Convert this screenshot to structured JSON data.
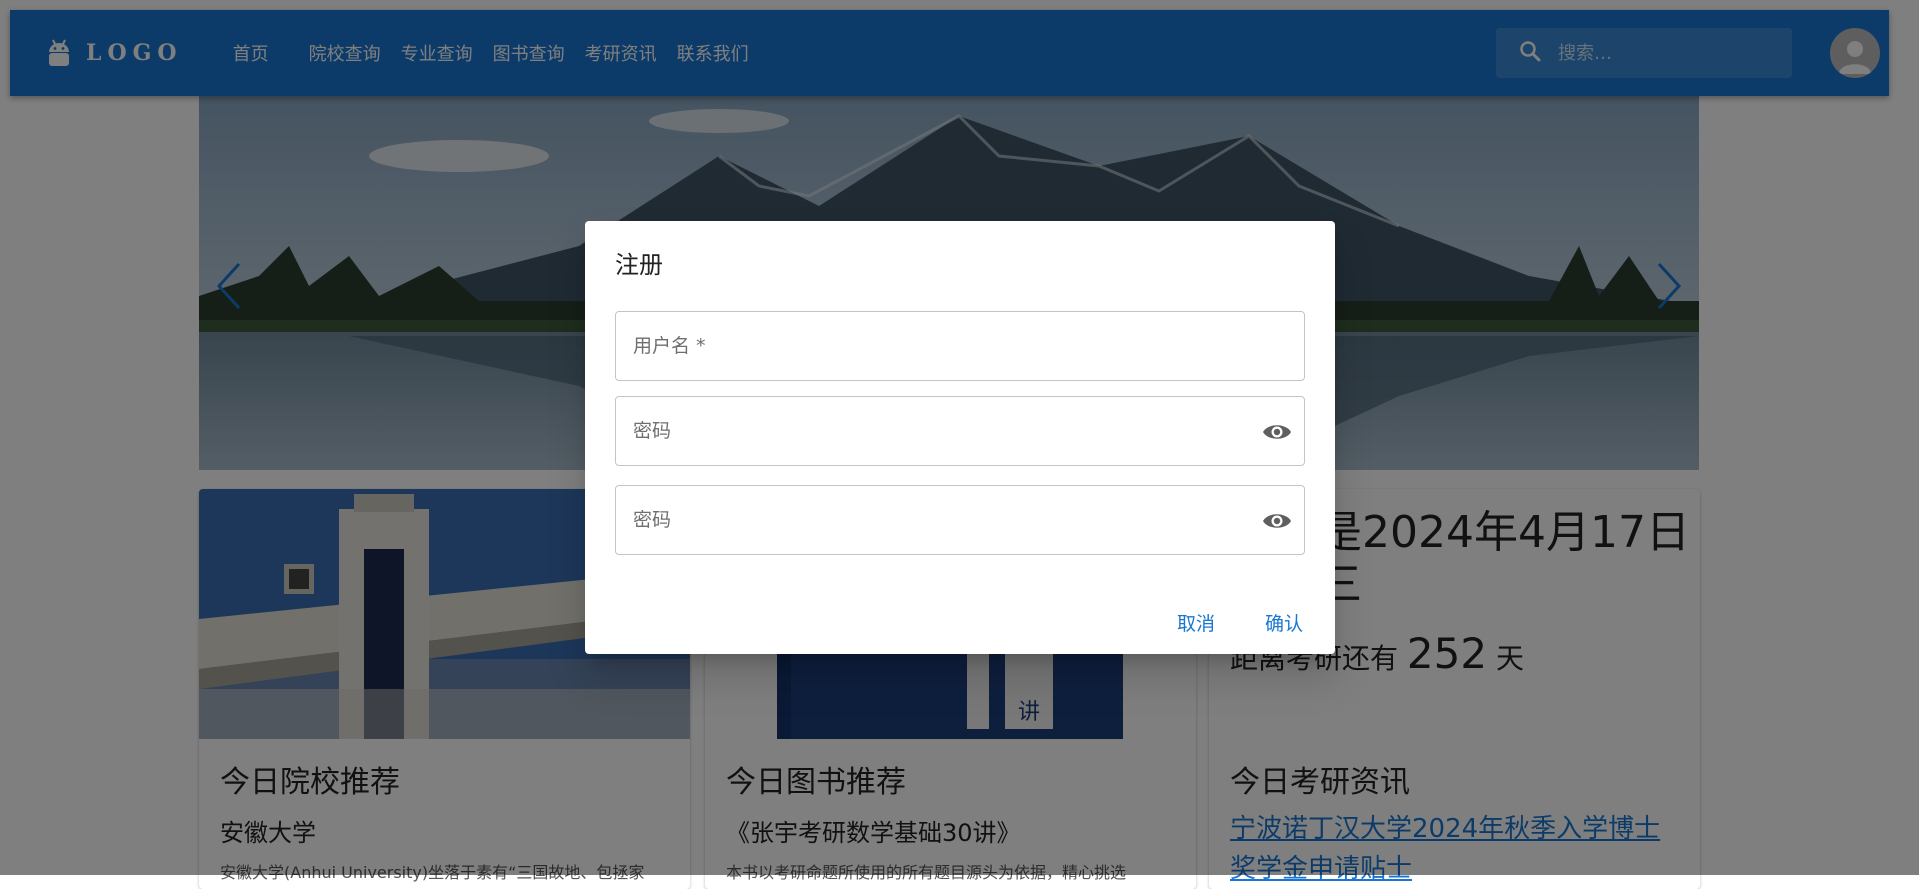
{
  "header": {
    "logo_text": "LOGO",
    "nav": [
      "首页",
      "院校查询",
      "专业查询",
      "图书查询",
      "考研资讯",
      "联系我们"
    ],
    "search_placeholder": "搜索…"
  },
  "cards": {
    "school": {
      "title": "今日院校推荐",
      "name": "安徽大学",
      "desc": "安徽大学(Anhui University)坐落于素有“三国故地、包拯家"
    },
    "book": {
      "title": "今日图书推荐",
      "name": "《张宇考研数学基础30讲》",
      "desc": "本书以考研命题所使用的所有题目源头为依据，精心挑选"
    },
    "date": {
      "line1": "今天是2024年4月17日",
      "line2": "星期三",
      "count_prefix": "距离考研还有",
      "count_value": "252",
      "count_unit": "天"
    },
    "news": {
      "title": "今日考研资讯",
      "link": "宁波诺丁汉大学2024年秋季入学博士奖学金申请贴士"
    }
  },
  "dialog": {
    "title": "注册",
    "username_placeholder": "用户名 *",
    "password_placeholder": "密码",
    "confirm_password_placeholder": "密码",
    "cancel_label": "取消",
    "confirm_label": "确认"
  },
  "colors": {
    "primary": "#1976d2",
    "backdrop": "rgba(0,0,0,0.5)"
  },
  "icons": {
    "logo": "android-icon",
    "search": "search-icon",
    "avatar": "person-icon",
    "eye": "eye-icon",
    "prev": "chevron-left-icon",
    "next": "chevron-right-icon"
  }
}
